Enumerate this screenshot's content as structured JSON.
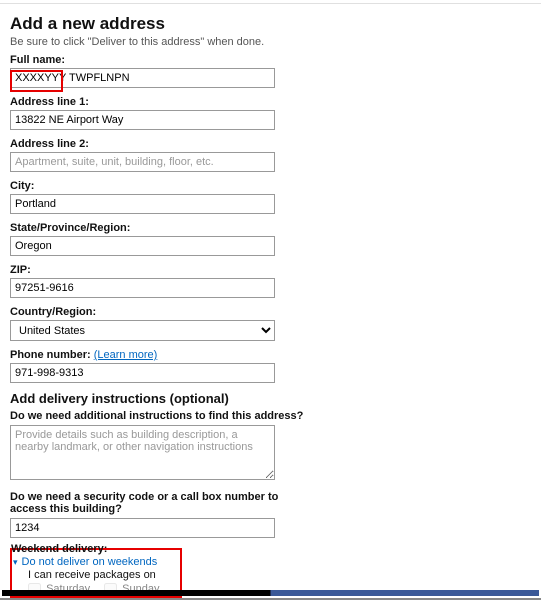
{
  "header": {
    "title": "Add a new address",
    "subtitle": "Be sure to click \"Deliver to this address\" when done."
  },
  "form": {
    "fullname_label": "Full name:",
    "fullname_value": "XXXXYYY TWPFLNPN",
    "address1_label": "Address line 1:",
    "address1_value": "13822 NE Airport Way",
    "address2_label": "Address line 2:",
    "address2_placeholder": "Apartment, suite, unit, building, floor, etc.",
    "city_label": "City:",
    "city_value": "Portland",
    "state_label": "State/Province/Region:",
    "state_value": "Oregon",
    "zip_label": "ZIP:",
    "zip_value": "97251-9616",
    "country_label": "Country/Region:",
    "country_value": "United States",
    "phone_label": "Phone number:",
    "phone_learn_more": "(Learn more)",
    "phone_value": "971-998-9313"
  },
  "delivery": {
    "heading": "Add delivery instructions (optional)",
    "additional_label": "Do we need additional instructions to find this address?",
    "additional_placeholder": "Provide details such as building description, a nearby landmark, or other navigation instructions",
    "security_label": "Do we need a security code or a call box number to access this building?",
    "security_value": "1234",
    "weekend_label": "Weekend delivery:",
    "weekend_option": "Do not deliver on weekends",
    "weekend_subtext": "I can receive packages on",
    "saturday_label": "Saturday",
    "sunday_label": "Sunday"
  }
}
